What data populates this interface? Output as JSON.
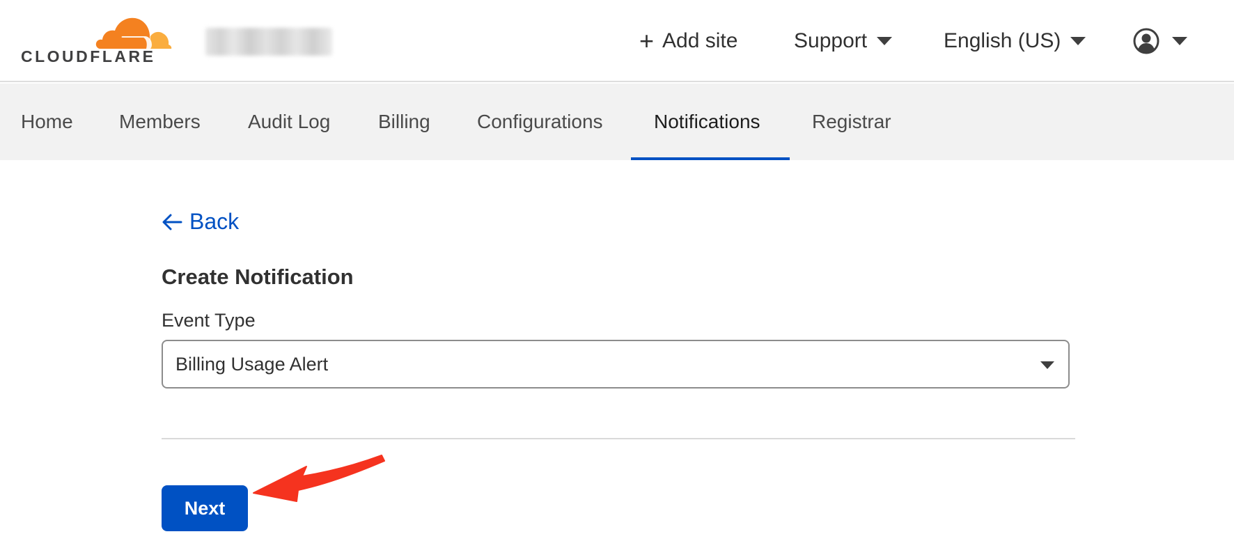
{
  "brand": {
    "wordmark": "CLOUDFLARE",
    "orange": "#f48120",
    "light_orange": "#faad3f"
  },
  "header": {
    "add_site": "Add site",
    "support": "Support",
    "language": "English (US)",
    "plus_icon": "plus-icon",
    "user_icon": "user-avatar-icon"
  },
  "tabs": [
    {
      "label": "Home"
    },
    {
      "label": "Members"
    },
    {
      "label": "Audit Log"
    },
    {
      "label": "Billing"
    },
    {
      "label": "Configurations"
    },
    {
      "label": "Notifications",
      "active": true
    },
    {
      "label": "Registrar"
    }
  ],
  "main": {
    "back_label": "Back",
    "title": "Create Notification",
    "event_type_label": "Event Type",
    "event_type_value": "Billing Usage Alert",
    "next_label": "Next"
  },
  "colors": {
    "accent": "#0051c3",
    "annotation": "#f5331f"
  }
}
